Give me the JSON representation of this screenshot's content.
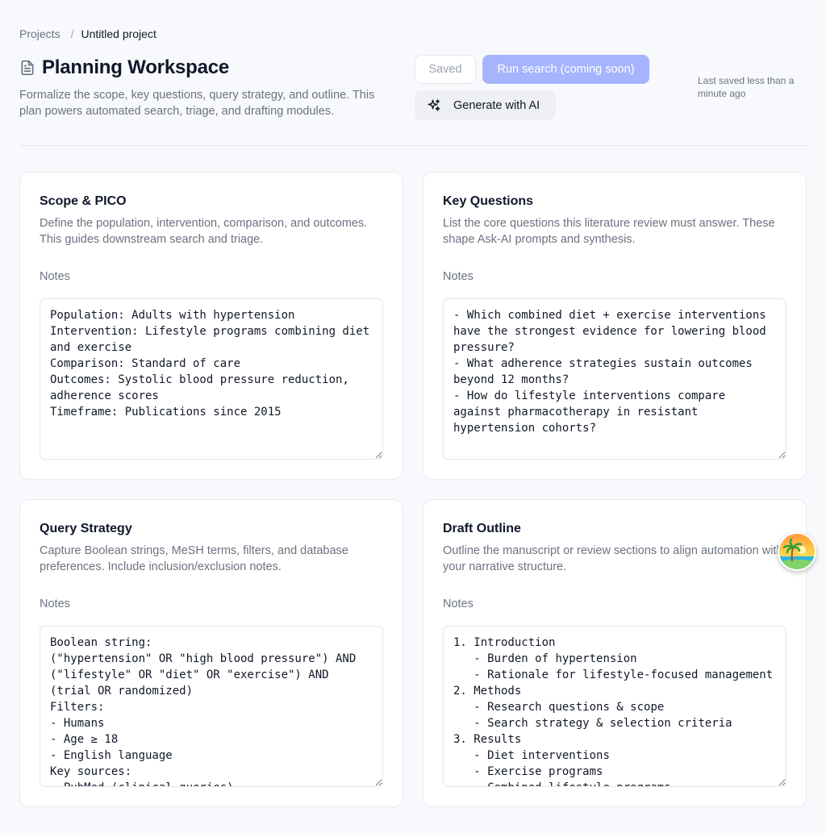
{
  "breadcrumb": {
    "projects": "Projects",
    "separator": "/",
    "current": "Untitled project"
  },
  "header": {
    "title": "Planning Workspace",
    "title_icon": "document-icon",
    "description": "Formalize the scope, key questions, query strategy, and outline. This plan powers automated search, triage, and drafting modules.",
    "saved_label": "Saved",
    "run_search_label": "Run search (coming soon)",
    "generate_label": "Generate with AI",
    "last_saved": "Last saved less than a minute ago"
  },
  "colors": {
    "accent_disabled": "#a5b4fc",
    "background": "#f8f9fc"
  },
  "cards": {
    "scope": {
      "title": "Scope & PICO",
      "description": "Define the population, intervention, comparison, and outcomes. This guides downstream search and triage.",
      "notes_label": "Notes",
      "notes": "Population: Adults with hypertension\nIntervention: Lifestyle programs combining diet and exercise\nComparison: Standard of care\nOutcomes: Systolic blood pressure reduction, adherence scores\nTimeframe: Publications since 2015"
    },
    "questions": {
      "title": "Key Questions",
      "description": "List the core questions this literature review must answer. These shape Ask-AI prompts and synthesis.",
      "notes_label": "Notes",
      "notes": "- Which combined diet + exercise interventions have the strongest evidence for lowering blood pressure?\n- What adherence strategies sustain outcomes beyond 12 months?\n- How do lifestyle interventions compare against pharmacotherapy in resistant hypertension cohorts?"
    },
    "query": {
      "title": "Query Strategy",
      "description": "Capture Boolean strings, MeSH terms, filters, and database preferences. Include inclusion/exclusion notes.",
      "notes_label": "Notes",
      "notes": "Boolean string:\n(\"hypertension\" OR \"high blood pressure\") AND (\"lifestyle\" OR \"diet\" OR \"exercise\") AND (trial OR randomized)\nFilters:\n- Humans\n- Age ≥ 18\n- English language\nKey sources:\n- PubMed (clinical queries)"
    },
    "outline": {
      "title": "Draft Outline",
      "description": "Outline the manuscript or review sections to align automation with your narrative structure.",
      "notes_label": "Notes",
      "notes": "1. Introduction\n   - Burden of hypertension\n   - Rationale for lifestyle-focused management\n2. Methods\n   - Research questions & scope\n   - Search strategy & selection criteria\n3. Results\n   - Diet interventions\n   - Exercise programs\n   - Combined lifestyle programs"
    }
  },
  "avatar_icon": "beach-avatar-icon"
}
